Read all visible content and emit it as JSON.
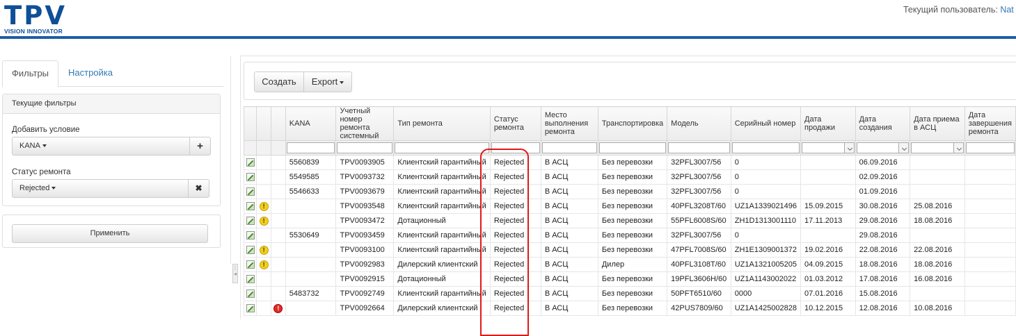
{
  "header": {
    "logo_main": "TPV",
    "logo_sub": "VISION INNOVATOR",
    "user_label": "Текущий пользователь:",
    "user_name": "Nat",
    "brand_color": "#1c5da6"
  },
  "left_panel": {
    "tabs": [
      {
        "label": "Фильтры",
        "active": true
      },
      {
        "label": "Настройка",
        "active": false
      }
    ],
    "current_filters_title": "Текущие фильтры",
    "add_condition_label": "Добавить условие",
    "add_condition_value": "KANA",
    "add_icon": "+",
    "repair_status_label": "Статус ремонта",
    "repair_status_value": "Rejected",
    "remove_icon": "✖",
    "apply_label": "Применить"
  },
  "toolbar": {
    "create_label": "Создать",
    "export_label": "Export"
  },
  "grid": {
    "columns": [
      "",
      "",
      "",
      "KANA",
      "Учетный номер ремонта системный",
      "Тип ремонта",
      "Статус ремонта",
      "Место выполнения ремонта",
      "Транспортировка",
      "Модель",
      "Серийный номер",
      "Дата продажи",
      "Дата создания",
      "Дата приема в АСЦ",
      "Дата завершения ремонта"
    ],
    "rows": [
      {
        "warn": false,
        "err": false,
        "cells": [
          "5560839",
          "TPV0093905",
          "Клиентский гарантийный",
          "Rejected",
          "В АСЦ",
          "Без перевозки",
          "32PFL3007/56",
          "0",
          "",
          "06.09.2016",
          ""
        ]
      },
      {
        "warn": false,
        "err": false,
        "cells": [
          "5549585",
          "TPV0093732",
          "Клиентский гарантийный",
          "Rejected",
          "В АСЦ",
          "Без перевозки",
          "32PFL3007/56",
          "0",
          "",
          "02.09.2016",
          ""
        ]
      },
      {
        "warn": false,
        "err": false,
        "cells": [
          "5546633",
          "TPV0093679",
          "Клиентский гарантийный",
          "Rejected",
          "В АСЦ",
          "Без перевозки",
          "32PFL3007/56",
          "0",
          "",
          "01.09.2016",
          ""
        ]
      },
      {
        "warn": true,
        "err": false,
        "cells": [
          "",
          "TPV0093548",
          "Клиентский гарантийный",
          "Rejected",
          "В АСЦ",
          "Без перевозки",
          "40PFL3208T/60",
          "UZ1A1339021496",
          "15.09.2015",
          "30.08.2016",
          "25.08.2016"
        ]
      },
      {
        "warn": true,
        "err": false,
        "cells": [
          "",
          "TPV0093472",
          "Дотационный",
          "Rejected",
          "В АСЦ",
          "Без перевозки",
          "55PFL6008S/60",
          "ZH1D1313001110",
          "17.11.2013",
          "29.08.2016",
          "18.08.2016"
        ]
      },
      {
        "warn": false,
        "err": false,
        "cells": [
          "5530649",
          "TPV0093459",
          "Клиентский гарантийный",
          "Rejected",
          "В АСЦ",
          "Без перевозки",
          "32PFL3007/56",
          "0",
          "",
          "29.08.2016",
          ""
        ]
      },
      {
        "warn": true,
        "err": false,
        "cells": [
          "",
          "TPV0093100",
          "Клиентский гарантийный",
          "Rejected",
          "В АСЦ",
          "Без перевозки",
          "47PFL7008S/60",
          "ZH1E1309001372",
          "19.02.2016",
          "22.08.2016",
          "22.08.2016"
        ]
      },
      {
        "warn": true,
        "err": false,
        "cells": [
          "",
          "TPV0092983",
          "Дилерский клиентский",
          "Rejected",
          "В АСЦ",
          "Дилер",
          "40PFL3108T/60",
          "UZ1A1321005205",
          "04.09.2015",
          "18.08.2016",
          "18.08.2016"
        ]
      },
      {
        "warn": false,
        "err": false,
        "cells": [
          "",
          "TPV0092915",
          "Дотационный",
          "Rejected",
          "В АСЦ",
          "Без перевозки",
          "19PFL3606H/60",
          "UZ1A1143002022",
          "01.03.2012",
          "17.08.2016",
          "16.08.2016"
        ]
      },
      {
        "warn": false,
        "err": false,
        "cells": [
          "5483732",
          "TPV0092749",
          "Клиентский гарантийный",
          "Rejected",
          "В АСЦ",
          "Без перевозки",
          "50PFT6510/60",
          "0000",
          "07.01.2016",
          "15.08.2016",
          ""
        ]
      },
      {
        "warn": false,
        "err": true,
        "cells": [
          "",
          "TPV0092664",
          "Дилерский клиентский",
          "Rejected",
          "В АСЦ",
          "Без перевозки",
          "42PUS7809/60",
          "UZ1A1425002828",
          "10.12.2015",
          "12.08.2016",
          "10.08.2016"
        ]
      }
    ]
  },
  "colors": {
    "annotation_circle": "#e01818",
    "warning": "#f2cf1e",
    "error": "#e02a2a"
  }
}
